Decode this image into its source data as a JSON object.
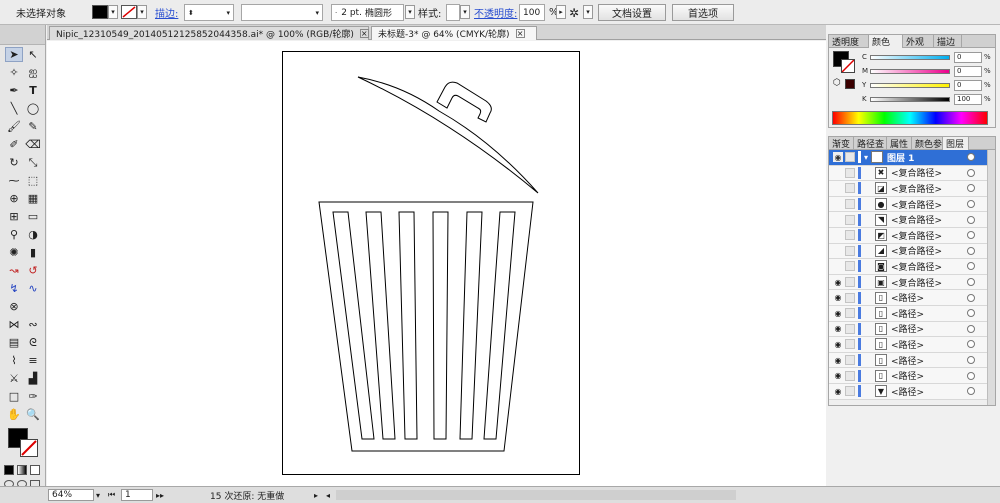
{
  "control_bar": {
    "no_selection": "未选择对象",
    "stroke_label": "描边:",
    "stroke_weight": "",
    "brush_size": "2 pt.",
    "brush_shape": "椭圆形",
    "style_label": "样式:",
    "opacity_label": "不透明度:",
    "opacity_value": "100",
    "opacity_unit": "%",
    "doc_setup": "文档设置",
    "prefs": "首选项"
  },
  "tabs": [
    {
      "label": "Nipic_12310549_20140512125852044358.ai* @ 100% (RGB/轮廓)"
    },
    {
      "label": "未标题-3* @ 64% (CMYK/轮廓)"
    }
  ],
  "color_panel": {
    "tabs": [
      "透明度",
      "颜色",
      "外观",
      "描边"
    ],
    "channels": [
      {
        "name": "C",
        "value": "0",
        "unit": "%"
      },
      {
        "name": "M",
        "value": "0",
        "unit": "%"
      },
      {
        "name": "Y",
        "value": "0",
        "unit": "%"
      },
      {
        "name": "K",
        "value": "100",
        "unit": "%"
      }
    ]
  },
  "layers_panel": {
    "tabs": [
      "渐变",
      "路径查",
      "属性",
      "颜色参",
      "图层"
    ],
    "top_layer": "图层 1",
    "rows": [
      {
        "name": "<复合路径>",
        "eye": false
      },
      {
        "name": "<复合路径>",
        "eye": false
      },
      {
        "name": "<复合路径>",
        "eye": false
      },
      {
        "name": "<复合路径>",
        "eye": false
      },
      {
        "name": "<复合路径>",
        "eye": false
      },
      {
        "name": "<复合路径>",
        "eye": false
      },
      {
        "name": "<复合路径>",
        "eye": false
      },
      {
        "name": "<复合路径>",
        "eye": true
      },
      {
        "name": "<路径>",
        "eye": true
      },
      {
        "name": "<路径>",
        "eye": true
      },
      {
        "name": "<路径>",
        "eye": true
      },
      {
        "name": "<路径>",
        "eye": true
      },
      {
        "name": "<路径>",
        "eye": true
      },
      {
        "name": "<路径>",
        "eye": true
      },
      {
        "name": "<路径>",
        "eye": true
      }
    ]
  },
  "status_bar": {
    "zoom": "64%",
    "page": "1",
    "undo_info": "15 次还原: 无重做"
  },
  "colors": {
    "layer_highlight": "#2f6fd6",
    "link_blue": "#2a4fd0"
  }
}
